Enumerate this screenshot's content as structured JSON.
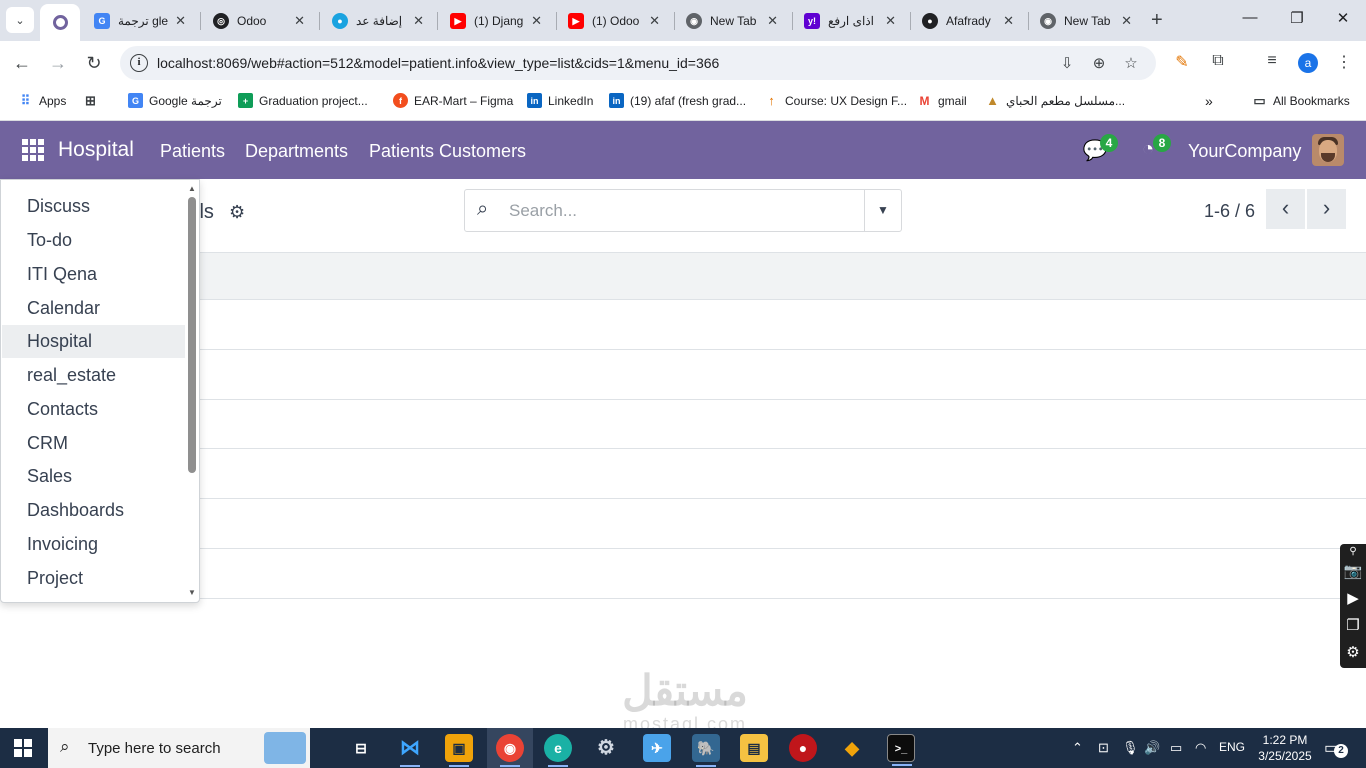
{
  "browser": {
    "tabs": [
      {
        "title": "ترجمة gle",
        "favicon": "google-translate-icon",
        "color": "#4285f4"
      },
      {
        "title": "Odoo",
        "favicon": "openai-icon",
        "color": "#202124"
      },
      {
        "title": "إضافة عد",
        "favicon": "mostaql-icon",
        "color": "#1dbf73"
      },
      {
        "title": "(1) Djang",
        "favicon": "youtube-icon",
        "color": "#ff0000"
      },
      {
        "title": "(1) Odoo",
        "favicon": "youtube-icon",
        "color": "#ff0000"
      },
      {
        "title": "New Tab",
        "favicon": "chrome-icon",
        "color": "#5f6368"
      },
      {
        "title": "اذاى ارفع",
        "favicon": "yahoo-icon",
        "color": "#6001d2"
      },
      {
        "title": "Afafrady",
        "favicon": "github-icon",
        "color": "#202124"
      },
      {
        "title": "New Tab",
        "favicon": "chrome-icon",
        "color": "#5f6368"
      }
    ],
    "url": "localhost:8069/web#action=512&model=patient.info&view_type=list&cids=1&menu_id=366",
    "profile_initial": "a",
    "bookmarks": [
      {
        "label": "Apps",
        "icon": "apps-grid-icon"
      },
      {
        "label": "",
        "icon": "tab-groups-icon"
      },
      {
        "label": "Google ترجمة",
        "icon": "google-translate-icon"
      },
      {
        "label": "Graduation project...",
        "icon": "sheets-icon"
      },
      {
        "label": "EAR-Mart – Figma",
        "icon": "figma-icon"
      },
      {
        "label": "LinkedIn",
        "icon": "linkedin-icon"
      },
      {
        "label": "(19) afaf (fresh grad...",
        "icon": "linkedin-icon"
      },
      {
        "label": "Course: UX Design F...",
        "icon": "course-icon"
      },
      {
        "label": "gmail",
        "icon": "gmail-icon"
      },
      {
        "label": "مسلسل مطعم الحباي...",
        "icon": "site-icon"
      }
    ],
    "all_bookmarks": "All Bookmarks",
    "more_bookmarks": "»"
  },
  "odoo": {
    "brand": "Hospital",
    "menu": [
      "Patients",
      "Departments",
      "Patients Customers"
    ],
    "messages_count": "4",
    "activities_count": "8",
    "company": "YourCompany",
    "page_title_partial": "ils",
    "search_placeholder": "Search...",
    "pager": "1-6 / 6",
    "list_rows": 6
  },
  "apps_dropdown": {
    "items": [
      "Discuss",
      "To-do",
      "ITI Qena",
      "Calendar",
      "Hospital",
      "real_estate",
      "Contacts",
      "CRM",
      "Sales",
      "Dashboards",
      "Invoicing",
      "Project"
    ],
    "active": "Hospital"
  },
  "watermark": {
    "arabic": "مستقل",
    "latin": "mostaql.com"
  },
  "taskbar": {
    "search_placeholder": "Type here to search",
    "time": "1:22 PM",
    "date": "3/25/2025",
    "language": "ENG",
    "notifications": "2"
  },
  "colors": {
    "odoo_primary": "#71639e",
    "badge_green": "#28a745",
    "taskbar": "#1c2d44"
  }
}
